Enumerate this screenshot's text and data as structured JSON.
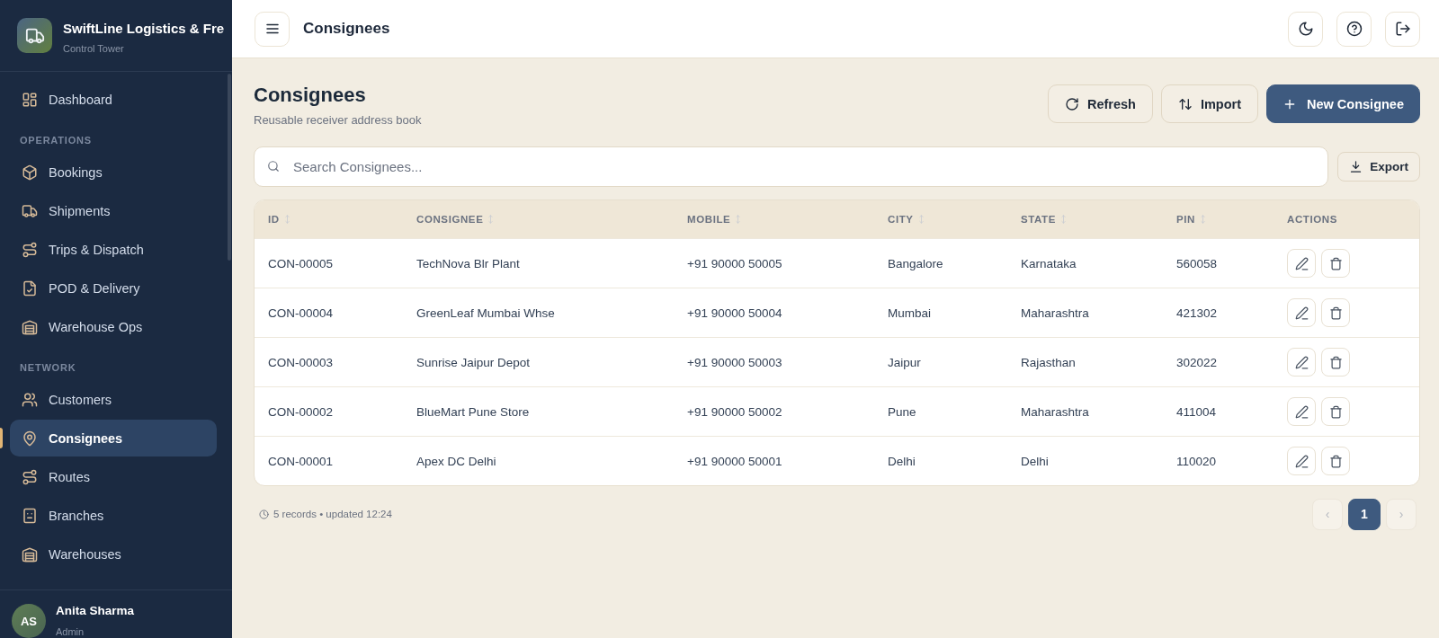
{
  "sidebar": {
    "brand": {
      "title": "SwiftLine Logistics & Fre",
      "subtitle": "Control Tower"
    },
    "sections": [
      {
        "items": [
          {
            "label": "Dashboard",
            "selected": false
          }
        ]
      },
      {
        "heading": "OPERATIONS",
        "items": [
          {
            "label": "Bookings",
            "selected": false
          },
          {
            "label": "Shipments",
            "selected": false
          },
          {
            "label": "Trips & Dispatch",
            "selected": false
          },
          {
            "label": "POD & Delivery",
            "selected": false
          },
          {
            "label": "Warehouse Ops",
            "selected": false
          }
        ]
      },
      {
        "heading": "NETWORK",
        "items": [
          {
            "label": "Customers",
            "selected": false
          },
          {
            "label": "Consignees",
            "selected": true
          },
          {
            "label": "Routes",
            "selected": false
          },
          {
            "label": "Branches",
            "selected": false
          },
          {
            "label": "Warehouses",
            "selected": false
          }
        ]
      }
    ],
    "user": {
      "initials": "AS",
      "name": "Anita Sharma",
      "role": "Admin"
    }
  },
  "header": {
    "title": "Consignees"
  },
  "page": {
    "title": "Consignees",
    "subtitle": "Reusable receiver address book",
    "actions": [
      {
        "label": "Refresh",
        "kind": "secondary"
      },
      {
        "label": "Import",
        "kind": "secondary"
      },
      {
        "label": "New Consignee",
        "kind": "primary"
      }
    ]
  },
  "search": {
    "placeholder": "Search Consignees..."
  },
  "export": {
    "label": "Export"
  },
  "table": {
    "columns": [
      {
        "label": "ID",
        "sortable": true
      },
      {
        "label": "CONSIGNEE",
        "sortable": true
      },
      {
        "label": "MOBILE",
        "sortable": true
      },
      {
        "label": "CITY",
        "sortable": true
      },
      {
        "label": "STATE",
        "sortable": true
      },
      {
        "label": "PIN",
        "sortable": true
      },
      {
        "label": "ACTIONS",
        "sortable": false
      }
    ],
    "rows": [
      {
        "cells": [
          "CON-00005",
          "TechNova Blr Plant",
          "+91 90000 50005",
          "Bangalore",
          "Karnataka",
          "560058"
        ]
      },
      {
        "cells": [
          "CON-00004",
          "GreenLeaf Mumbai Whse",
          "+91 90000 50004",
          "Mumbai",
          "Maharashtra",
          "421302"
        ]
      },
      {
        "cells": [
          "CON-00003",
          "Sunrise Jaipur Depot",
          "+91 90000 50003",
          "Jaipur",
          "Rajasthan",
          "302022"
        ]
      },
      {
        "cells": [
          "CON-00002",
          "BlueMart Pune Store",
          "+91 90000 50002",
          "Pune",
          "Maharashtra",
          "411004"
        ]
      },
      {
        "cells": [
          "CON-00001",
          "Apex DC Delhi",
          "+91 90000 50001",
          "Delhi",
          "Delhi",
          "110020"
        ]
      }
    ]
  },
  "footer": {
    "summary": "5 records • updated 12:24"
  },
  "pagination": {
    "prev": {
      "label": "‹",
      "disabled": true
    },
    "pages": [
      {
        "label": "1",
        "selected": true
      }
    ],
    "next": {
      "label": "›",
      "disabled": true
    }
  }
}
